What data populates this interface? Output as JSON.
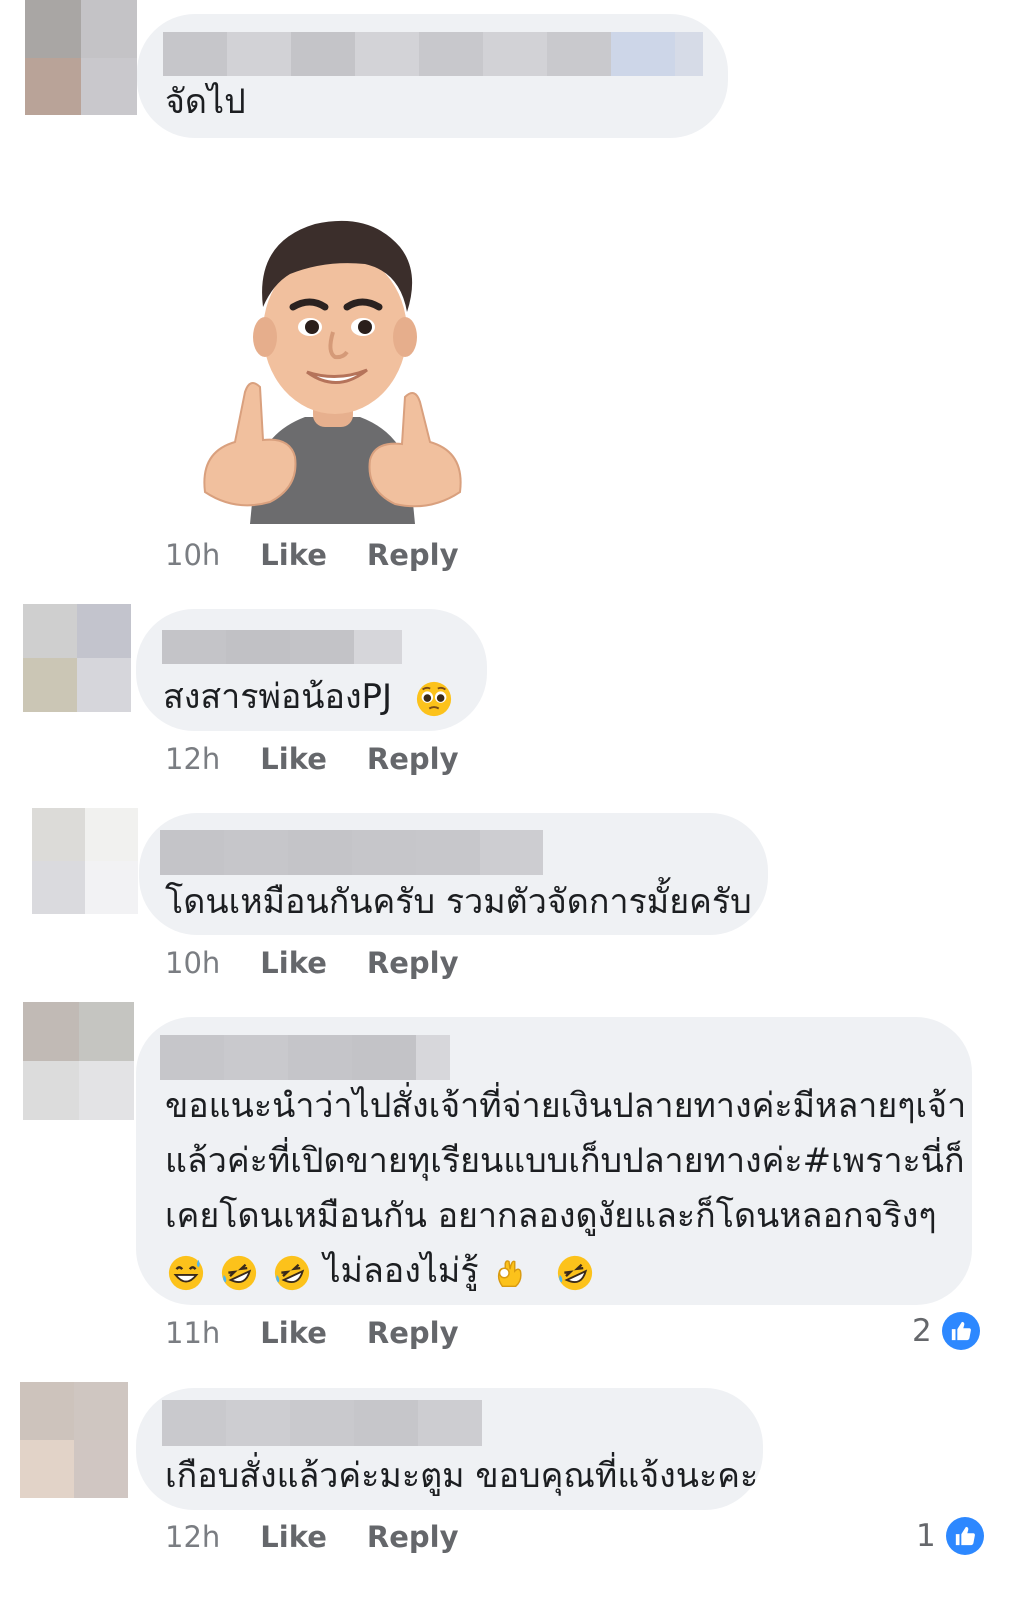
{
  "comments": [
    {
      "text": "จัดไป",
      "time": "10h",
      "like": "Like",
      "reply": "Reply",
      "sticker": "thumbs-up-avatar-sticker"
    },
    {
      "text": "สงสารพ่อน้องPJ",
      "emoji": "pleading-face",
      "time": "12h",
      "like": "Like",
      "reply": "Reply"
    },
    {
      "text": "โดนเหมือนกันครับ รวมตัวจัดการมั้ยครับ",
      "time": "10h",
      "like": "Like",
      "reply": "Reply"
    },
    {
      "lines": [
        "ขอแนะนำว่าไปสั่งเจ้าที่จ่ายเงินปลายทางค่ะมีหลายๆเจ้า",
        "แล้วค่ะที่เปิดขายทุเรียนแบบเก็บปลายทางค่ะ#เพราะนี่ก็",
        "เคยโดนเหมือนกัน อยากลองดูงัยและก็โดนหลอกจริงๆ"
      ],
      "last_line_text": "ไม่ลองไม่รู้",
      "time": "11h",
      "like": "Like",
      "reply": "Reply",
      "reaction_count": "2"
    },
    {
      "text": "เกือบสั่งแล้วค่ะมะตูม ขอบคุณที่แจ้งนะคะ",
      "time": "12h",
      "like": "Like",
      "reply": "Reply",
      "reaction_count": "1"
    }
  ],
  "colors": {
    "bubble": "#eff1f4",
    "like_badge": "#2d88ff",
    "meta_text": "#65676b"
  }
}
